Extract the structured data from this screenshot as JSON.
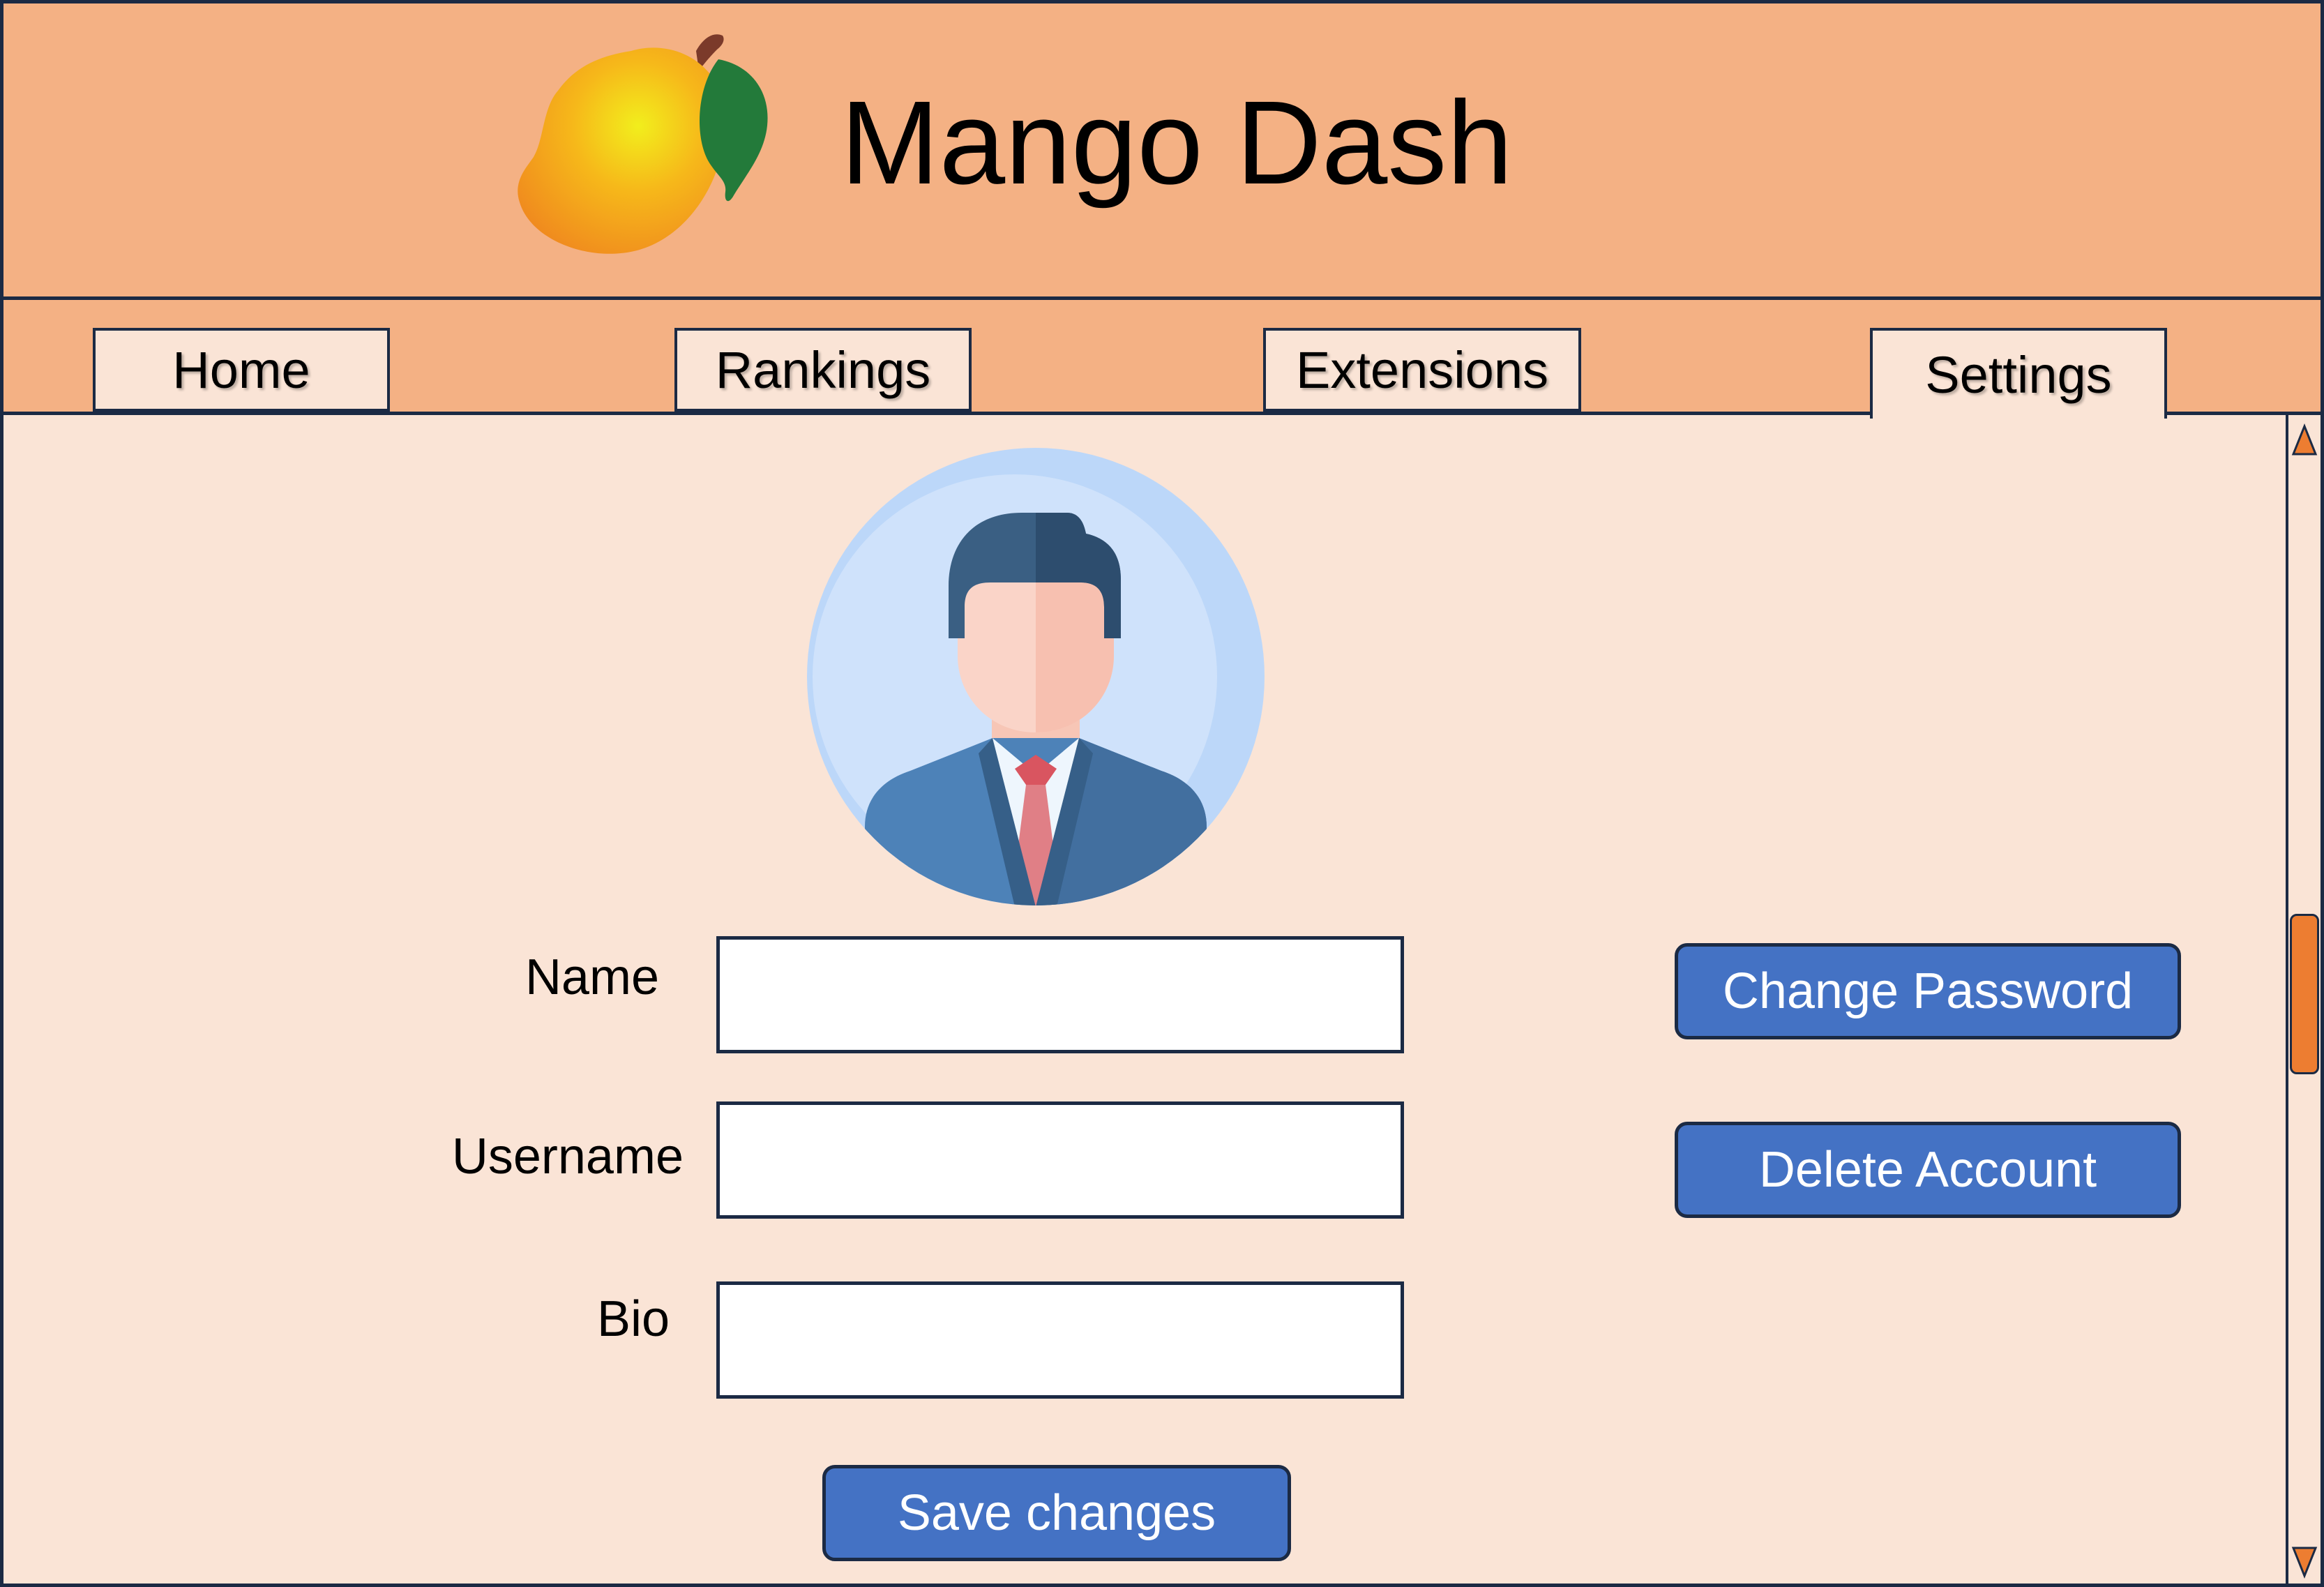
{
  "app": {
    "title": "Mango Dash",
    "logo_icon": "mango-icon"
  },
  "tabs": [
    {
      "label": "Home",
      "active": false
    },
    {
      "label": "Rankings",
      "active": false
    },
    {
      "label": "Extensions",
      "active": false
    },
    {
      "label": "Settings",
      "active": true
    }
  ],
  "profile": {
    "avatar_icon": "user-avatar-icon",
    "fields": [
      {
        "label": "Name",
        "value": "",
        "placeholder": ""
      },
      {
        "label": "Username",
        "value": "",
        "placeholder": ""
      },
      {
        "label": "Bio",
        "value": "",
        "placeholder": ""
      }
    ],
    "save_label": "Save changes"
  },
  "account": {
    "change_password_label": "Change Password",
    "delete_account_label": "Delete Account"
  },
  "colors": {
    "header_bg": "#f4b184",
    "content_bg": "#fae4d6",
    "button_bg": "#4472c4",
    "border": "#1b2a44",
    "scroll_accent": "#ed7d31"
  }
}
